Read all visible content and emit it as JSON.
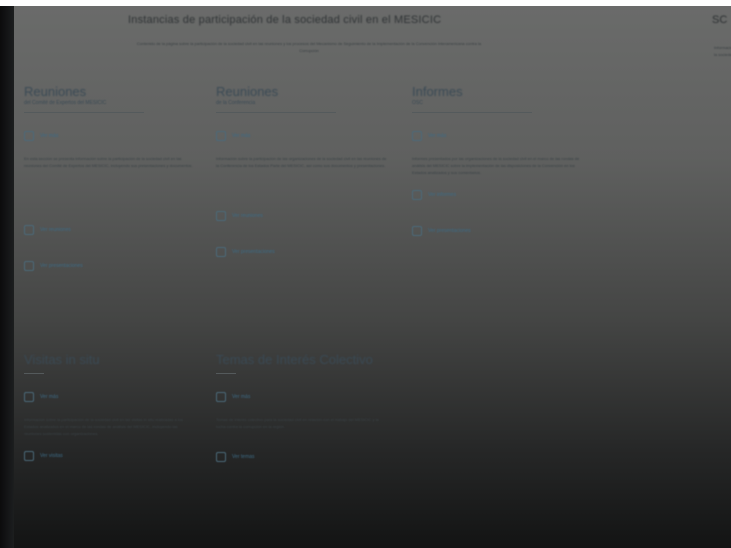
{
  "header": {
    "title": "Instancias de participación de la sociedad civil en el MESICIC",
    "subtitle": "Contenido de la página sobre la participación de la sociedad civil en las reuniones y los procesos del Mecanismo de Seguimiento de la Implementación de la Convención Interamericana contra la Corrupción",
    "corner_title": "SC",
    "corner_subtitle": "Información de la sociedad civil"
  },
  "cards": [
    {
      "title": "Reuniones",
      "subtitle": "del Comité de Expertos del MESICIC",
      "link": "Ver más",
      "description": "En esta sección se presenta información sobre la participación de la sociedad civil en las reuniones del Comité de Expertos del MESICIC, incluyendo sus presentaciones y documentos.",
      "link2": "Ver reuniones",
      "link3": "Ver presentaciones"
    },
    {
      "title": "Reuniones",
      "subtitle": "de la Conferencia",
      "link": "Ver más",
      "description": "Información sobre la participación de las organizaciones de la sociedad civil en las reuniones de la Conferencia de los Estados Parte del MESICIC, así como sus documentos y presentaciones.",
      "link2": "Ver reuniones",
      "link3": "Ver presentaciones"
    },
    {
      "title": "Informes",
      "subtitle": "OSC",
      "link": "Ver más",
      "description": "Informes presentados por las organizaciones de la sociedad civil en el marco de las rondas de análisis del MESICIC sobre la implementación de las disposiciones de la Convención en los Estados analizados y sus comentarios.",
      "link2": "Ver informes",
      "link3": "Ver presentaciones"
    },
    {
      "title": "Visitas in situ",
      "subtitle": "",
      "link": "Ver más",
      "description": "Información sobre la participación de la sociedad civil en las visitas in situ realizadas a los Estados analizados en el marco de las rondas de análisis del MESICIC, incluyendo las reuniones sostenidas con organizaciones.",
      "link2": "Ver visitas",
      "link3": ""
    },
    {
      "title": "Temas de Interés Colectivo",
      "subtitle": "",
      "link": "Ver más",
      "description": "Temas de interés colectivo para la sociedad civil en relación con el trabajo del MESICIC y la lucha contra la corrupción en la región.",
      "link2": "Ver temas",
      "link3": ""
    }
  ]
}
